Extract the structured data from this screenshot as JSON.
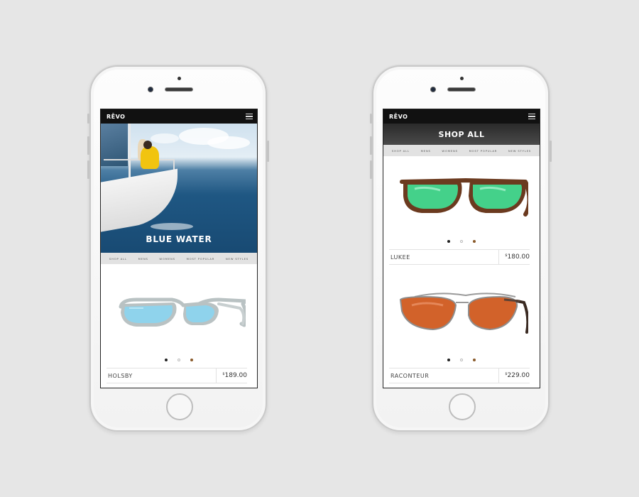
{
  "left_phone": {
    "logo": "RĒVO",
    "hero_title": "BLUE WATER",
    "subnav": [
      "SHOP ALL",
      "MENS",
      "WOMENS",
      "MOST POPULAR",
      "NEW STYLES"
    ],
    "product": {
      "name": "HOLSBY",
      "currency": "$",
      "price": "189.00",
      "dots": [
        "#222222",
        "#ffffff",
        "#8a5a2b"
      ],
      "lens_color": "#8fd3ec",
      "frame_color": "#b9c2c3"
    }
  },
  "right_phone": {
    "logo": "RĒVO",
    "title": "SHOP ALL",
    "subnav": [
      "SHOP ALL",
      "MENS",
      "WOMENS",
      "MOST POPULAR",
      "NEW STYLES"
    ],
    "products": [
      {
        "name": "LUKEE",
        "currency": "$",
        "price": "180.00",
        "dots": [
          "#222222",
          "#ffffff",
          "#8a5a2b"
        ],
        "lens_color": "#44d18a",
        "frame_color": "#6b3a1f"
      },
      {
        "name": "RACONTEUR",
        "currency": "$",
        "price": "229.00",
        "dots": [
          "#222222",
          "#ffffff",
          "#8a5a2b"
        ],
        "lens_color": "#d2622a",
        "frame_color": "#8e8e8e"
      }
    ]
  },
  "colors": {
    "background": "#e6e6e6",
    "topbar": "#111111",
    "subnav": "#e2e2e2"
  }
}
